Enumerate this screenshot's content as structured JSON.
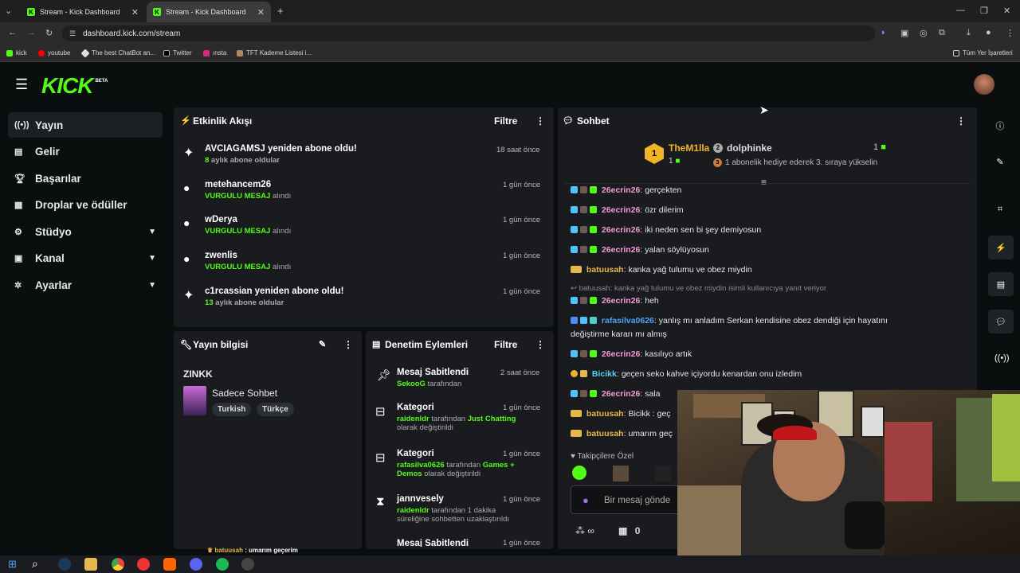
{
  "browser": {
    "tabs": [
      {
        "title": "Stream - Kick Dashboard"
      },
      {
        "title": "Stream - Kick Dashboard"
      }
    ],
    "url": "dashboard.kick.com/stream",
    "bookmarks": [
      "kick",
      "youtube",
      "The best ChatBot an...",
      "Twitter",
      "ınsta",
      "TFT Kademe Listesi i..."
    ],
    "bookmarks_folder": "Tüm Yer İşaretleri"
  },
  "app": {
    "logo": "KICK",
    "logo_tag": "BETA"
  },
  "sidebar": {
    "items": [
      {
        "label": "Yayın",
        "icon": "broadcast-icon"
      },
      {
        "label": "Gelir",
        "icon": "revenue-icon"
      },
      {
        "label": "Başarılar",
        "icon": "trophy-icon"
      },
      {
        "label": "Droplar ve ödüller",
        "icon": "gift-icon"
      },
      {
        "label": "Stüdyo",
        "icon": "studio-icon"
      },
      {
        "label": "Kanal",
        "icon": "channel-icon"
      },
      {
        "label": "Ayarlar",
        "icon": "gear-icon"
      }
    ]
  },
  "activity": {
    "title": "Etkinlik Akışı",
    "filter": "Filtre",
    "items": [
      {
        "name": "AVCIAGAMSJ yeniden abone oldu!",
        "detail_hl": "8",
        "detail": " aylık abone oldular",
        "time": "18 saat önce"
      },
      {
        "name": "metehancem26",
        "detail_hl": "VURGULU MESAJ",
        "detail": " alındı",
        "time": "1 gün önce"
      },
      {
        "name": "wDerya",
        "detail_hl": "VURGULU MESAJ",
        "detail": " alındı",
        "time": "1 gün önce"
      },
      {
        "name": "zwenlis",
        "detail_hl": "VURGULU MESAJ",
        "detail": " alındı",
        "time": "1 gün önce"
      },
      {
        "name": "c1rcassian yeniden abone oldu!",
        "detail_hl": "13",
        "detail": " aylık abone oldular",
        "time": "1 gün önce"
      }
    ]
  },
  "stream_info": {
    "title": "Yayın bilgisi",
    "stream_title": "ZINKK",
    "category": "Sadece Sohbet",
    "tags": [
      "Turkish",
      "Türkçe"
    ]
  },
  "moderation": {
    "title": "Denetim Eylemleri",
    "filter": "Filtre",
    "items": [
      {
        "action": "Mesaj Sabitlendi",
        "time": "2 saat önce",
        "user": "SekooG",
        "rest": " tarafından",
        "extra": "",
        "tail": ""
      },
      {
        "action": "Kategori",
        "time": "1 gün önce",
        "user": "raidenldr",
        "rest": " tarafından ",
        "extra": "Just Chatting",
        "tail": "olarak değiştirildi"
      },
      {
        "action": "Kategori",
        "time": "1 gün önce",
        "user": "rafasilva0626",
        "rest": " tarafından ",
        "extra": "Games + Demos",
        "tail": " olarak değiştirildi"
      },
      {
        "action": "jannvesely",
        "time": "1 gün önce",
        "user": "raidenldr",
        "rest": " tarafından 1 dakika",
        "extra": "",
        "tail": "süreliğine sohbetten uzaklaştırıldı"
      },
      {
        "action": "Mesaj Sabitlendi",
        "time": "1 gün önce",
        "user": "",
        "rest": "",
        "extra": "",
        "tail": ""
      }
    ]
  },
  "chat": {
    "title": "Sohbet",
    "leaderboard": {
      "first_name": "TheM1lla",
      "first_count": "1",
      "second_name": "dolphinke",
      "second_count": "1",
      "info": "1 abonelik hediye ederek 3. sıraya yükselin"
    },
    "messages": [
      {
        "user": "26ecrin26",
        "text": "gerçekten"
      },
      {
        "user": "26ecrin26",
        "text": "özr dilerim"
      },
      {
        "user": "26ecrin26",
        "text": "iki neden sen bi şey demiyosun"
      },
      {
        "user": "26ecrin26",
        "text": "yalan söylüyosun"
      },
      {
        "user": "batuusah",
        "text": "kanka yağ tulumu ve obez miydin"
      },
      {
        "user": "",
        "text": "batuusah: kanka yağ tulumu ve obez miydin isimli kullanıcıya yanıt veriyor"
      },
      {
        "user": "26ecrin26",
        "text": "heh"
      },
      {
        "user": "rafasilva0626",
        "text": "yanlış mı anladım Serkan kendisine obez dendiği için hayatını"
      },
      {
        "user": "",
        "text": "değiştirme kararı mı almış"
      },
      {
        "user": "26ecrin26",
        "text": "kasılıyo artık"
      },
      {
        "user": "Bicikk",
        "text": "geçen seko kahve içiyordu kenardan onu izledim"
      },
      {
        "user": "26ecrin26",
        "text": "sala"
      },
      {
        "user": "batuusah",
        "text": "Bicikk : geç"
      },
      {
        "user": "batuusah",
        "text": "umarım geç"
      }
    ],
    "followers_label": "Takipçilere Özel",
    "input_placeholder": "Bir mesaj gönde",
    "viewers": "∞",
    "count": "0"
  },
  "overlay_chat": {
    "user": "batuusah",
    "text": " : umarım geçerim"
  },
  "colors": {
    "accent": "#53fc18",
    "chat_pink": "#f49ad7",
    "chat_gold": "#e7b84a",
    "chat_blue": "#4fa3f7"
  }
}
